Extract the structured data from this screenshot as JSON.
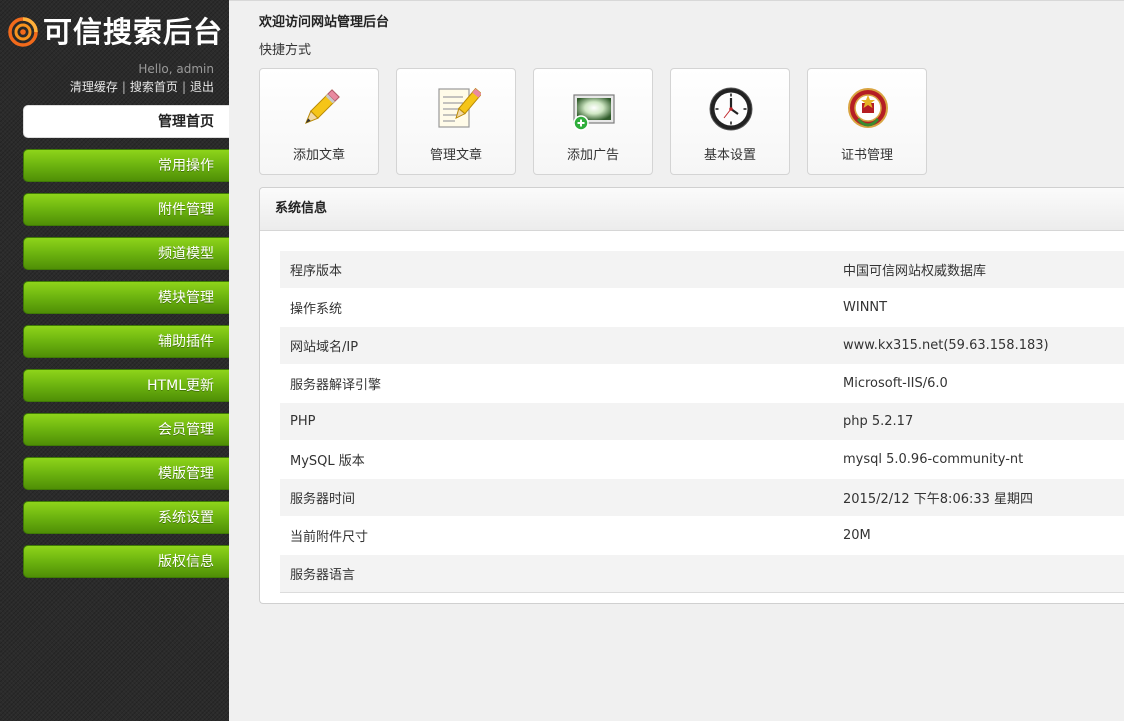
{
  "app": {
    "title": "可信搜索后台",
    "greeting": "Hello, admin",
    "links": [
      {
        "label": "清理缓存"
      },
      {
        "label": "搜索首页"
      },
      {
        "label": "退出"
      }
    ]
  },
  "sidebar": {
    "items": [
      {
        "label": "管理首页",
        "active": true
      },
      {
        "label": "常用操作"
      },
      {
        "label": "附件管理"
      },
      {
        "label": "频道模型"
      },
      {
        "label": "模块管理"
      },
      {
        "label": "辅助插件"
      },
      {
        "label": "HTML更新"
      },
      {
        "label": "会员管理"
      },
      {
        "label": "模版管理"
      },
      {
        "label": "系统设置"
      },
      {
        "label": "版权信息"
      }
    ]
  },
  "main": {
    "welcome": "欢迎访问网站管理后台",
    "shortcut_title": "快捷方式",
    "shortcuts": [
      {
        "label": "添加文章",
        "icon": "pencil-icon"
      },
      {
        "label": "管理文章",
        "icon": "document-edit-icon"
      },
      {
        "label": "添加广告",
        "icon": "image-add-icon"
      },
      {
        "label": "基本设置",
        "icon": "clock-icon"
      },
      {
        "label": "证书管理",
        "icon": "emblem-icon"
      }
    ],
    "panel_title": "系统信息",
    "info_rows": [
      {
        "key": "程序版本",
        "value": "中国可信网站权威数据库"
      },
      {
        "key": "操作系统",
        "value": "WINNT"
      },
      {
        "key": "网站域名/IP",
        "value": "www.kx315.net(59.63.158.183)"
      },
      {
        "key": "服务器解译引擎",
        "value": "Microsoft-IIS/6.0"
      },
      {
        "key": "PHP",
        "value": "php 5.2.17"
      },
      {
        "key": "MySQL 版本",
        "value": "mysql 5.0.96-community-nt"
      },
      {
        "key": "服务器时间",
        "value": "2015/2/12 下午8:06:33 星期四"
      },
      {
        "key": "当前附件尺寸",
        "value": "20M"
      },
      {
        "key": "服务器语言",
        "value": ""
      }
    ]
  },
  "colors": {
    "sidebar_bg": "#2b2b2b",
    "menu_green": "#6cb30f",
    "logo_orange": "#f26a1b"
  }
}
